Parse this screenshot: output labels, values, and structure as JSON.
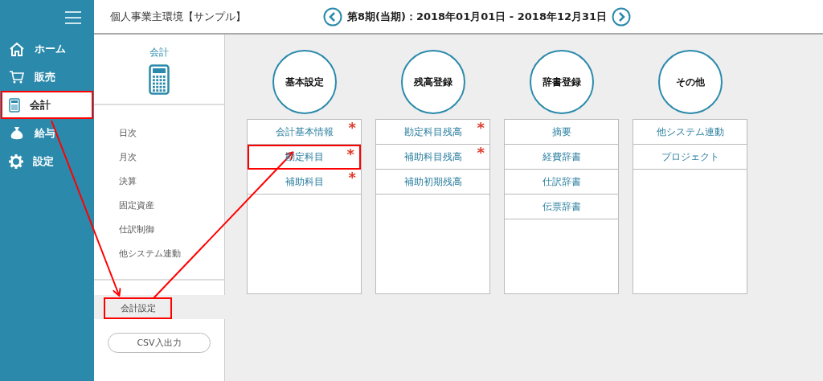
{
  "sidebar": {
    "items": [
      {
        "label": "ホーム",
        "selected": false,
        "highlighted": false
      },
      {
        "label": "販売",
        "selected": false,
        "highlighted": false
      },
      {
        "label": "会計",
        "selected": true,
        "highlighted": true
      },
      {
        "label": "給与",
        "selected": false,
        "highlighted": false
      },
      {
        "label": "設定",
        "selected": false,
        "highlighted": false
      }
    ]
  },
  "header": {
    "title": "個人事業主環境【サンプル】",
    "period": "第8期(当期)：2018年01月01日 - 2018年12月31日"
  },
  "left_panel": {
    "heading": "会計",
    "items": [
      "日次",
      "月次",
      "決算",
      "固定資産",
      "仕訳制御",
      "他システム連動"
    ],
    "tab": {
      "label": "会計設定",
      "highlighted": true
    },
    "csv_button": "CSV入出力"
  },
  "groups": [
    {
      "title": "基本設定",
      "items": [
        {
          "label": "会計基本情報",
          "mark": "*",
          "highlighted": false
        },
        {
          "label": "勘定科目",
          "mark": "*",
          "highlighted": true
        },
        {
          "label": "補助科目",
          "mark": "*",
          "highlighted": false
        }
      ]
    },
    {
      "title": "残高登録",
      "items": [
        {
          "label": "勘定科目残高",
          "mark": "*",
          "highlighted": false
        },
        {
          "label": "補助科目残高",
          "mark": "*",
          "highlighted": false
        },
        {
          "label": "補助初期残高",
          "highlighted": false
        }
      ]
    },
    {
      "title": "辞書登録",
      "items": [
        {
          "label": "摘要",
          "highlighted": false
        },
        {
          "label": "経費辞書",
          "highlighted": false
        },
        {
          "label": "仕訳辞書",
          "highlighted": false
        },
        {
          "label": "伝票辞書",
          "highlighted": false
        }
      ]
    },
    {
      "title": "その他",
      "items": [
        {
          "label": "他システム連動",
          "highlighted": false
        },
        {
          "label": "プロジェクト",
          "highlighted": false
        }
      ]
    }
  ]
}
